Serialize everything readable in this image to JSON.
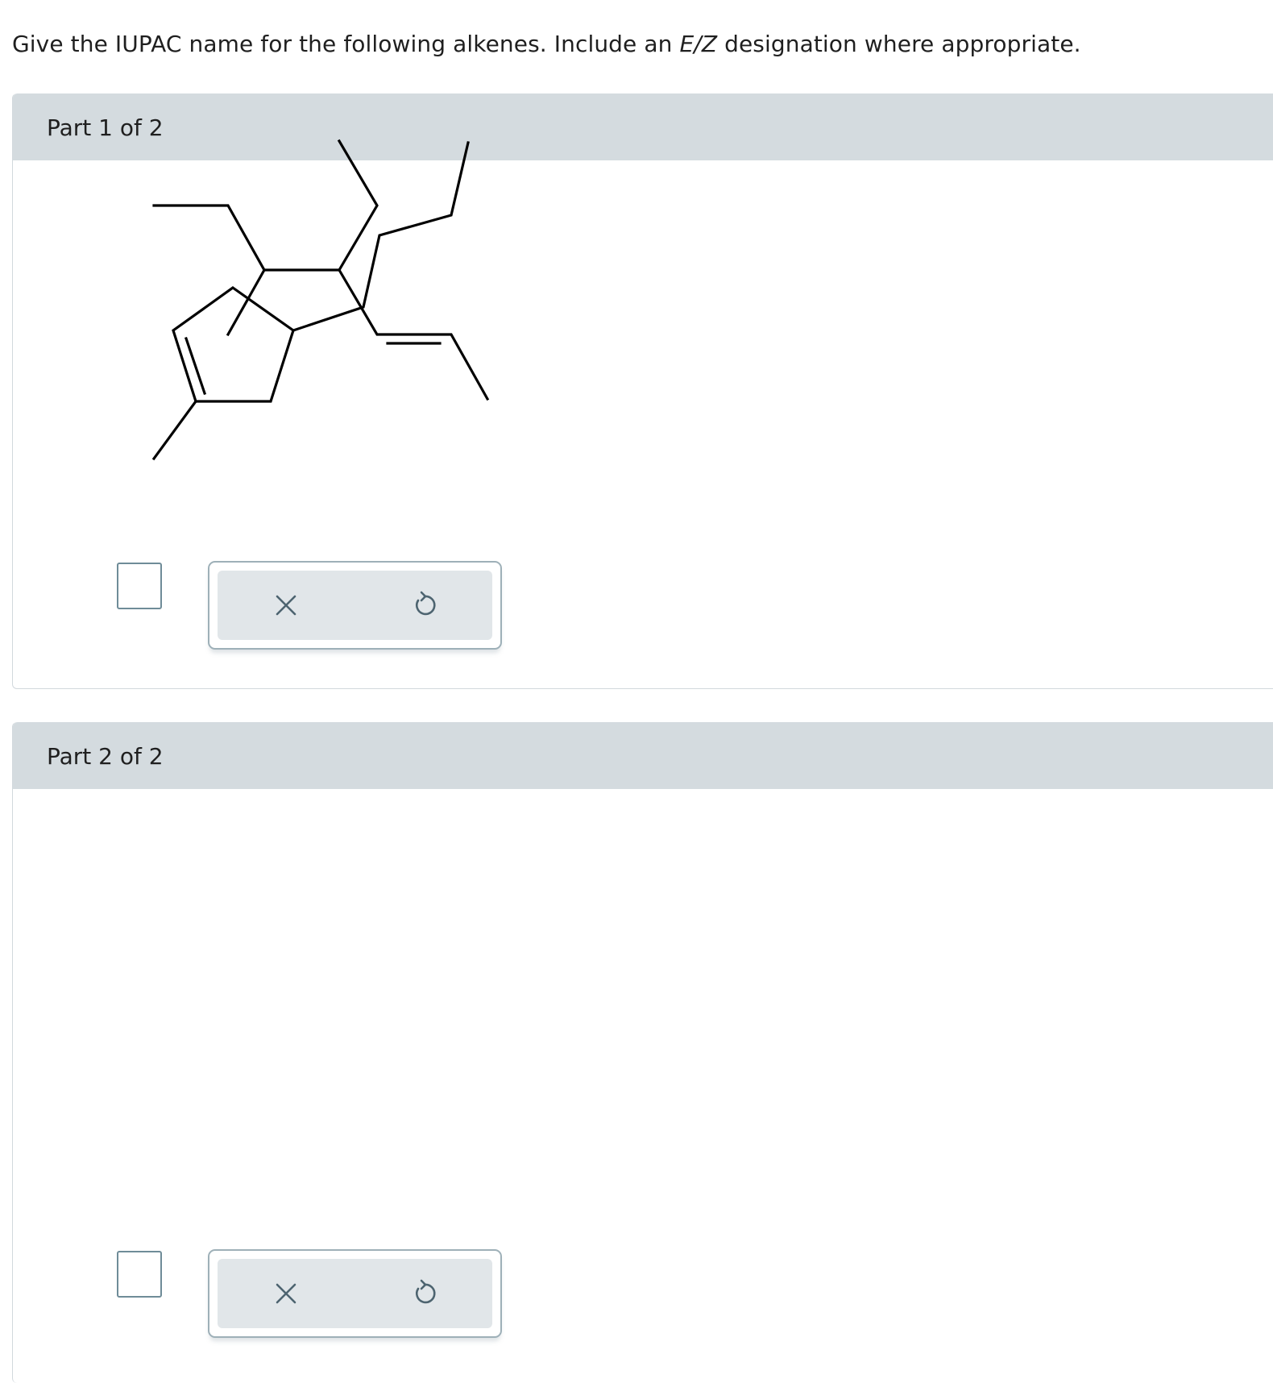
{
  "prompt": {
    "before": "Give the IUPAC name for the following alkenes. Include an ",
    "ez": "E/Z",
    "after": " designation where appropriate."
  },
  "parts": [
    {
      "title": "Part 1 of 2",
      "answer_value": "",
      "tools": [
        {
          "name": "clear",
          "icon": "x-icon"
        },
        {
          "name": "undo",
          "icon": "undo-icon"
        }
      ]
    },
    {
      "title": "Part 2 of 2",
      "answer_value": "",
      "tools": [
        {
          "name": "clear",
          "icon": "x-icon"
        },
        {
          "name": "undo",
          "icon": "undo-icon"
        }
      ]
    }
  ],
  "colors": {
    "header_bg": "#d4dbdf",
    "toolbar_bg": "#e1e6e9",
    "icon": "#4d6470",
    "answer_border": "#6f8c98"
  }
}
